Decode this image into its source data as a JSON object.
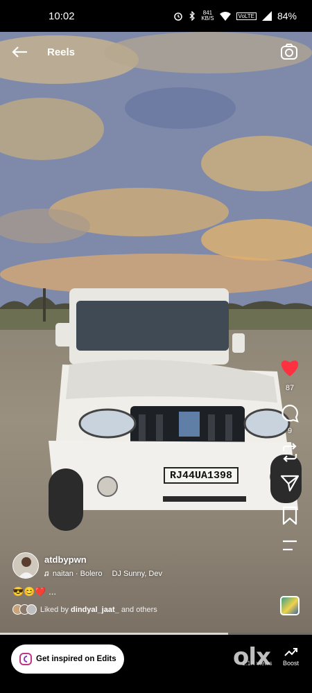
{
  "status_bar": {
    "time": "10:02",
    "data_speed_value": "841",
    "data_speed_unit": "KB/S",
    "network": "VoLTE",
    "battery": "84%",
    "icons": [
      "alarm-icon",
      "bluetooth-icon",
      "wifi-icon",
      "signal-icon"
    ]
  },
  "header": {
    "title": "Reels",
    "back_icon": "arrow-left-icon",
    "camera_icon": "camera-icon"
  },
  "actions": {
    "like_count": "87",
    "comment_count": "9",
    "like_color": "#ff3040"
  },
  "post": {
    "username": "atdbypwn",
    "audio_track": "naitan · Bolero",
    "audio_artist": "DJ Sunny, Dev",
    "caption": "😎😊❤️ ...",
    "liked_by_prefix": "Liked by",
    "liked_by_user": "dindyal_jaat_",
    "liked_by_suffix": "and others",
    "plate": "RJ44UA1398"
  },
  "progress": 0.73,
  "bottom": {
    "edits_label": "Get inspired on Edits",
    "views": "1.1K views",
    "boost_label": "Boost",
    "watermark": "olx"
  }
}
